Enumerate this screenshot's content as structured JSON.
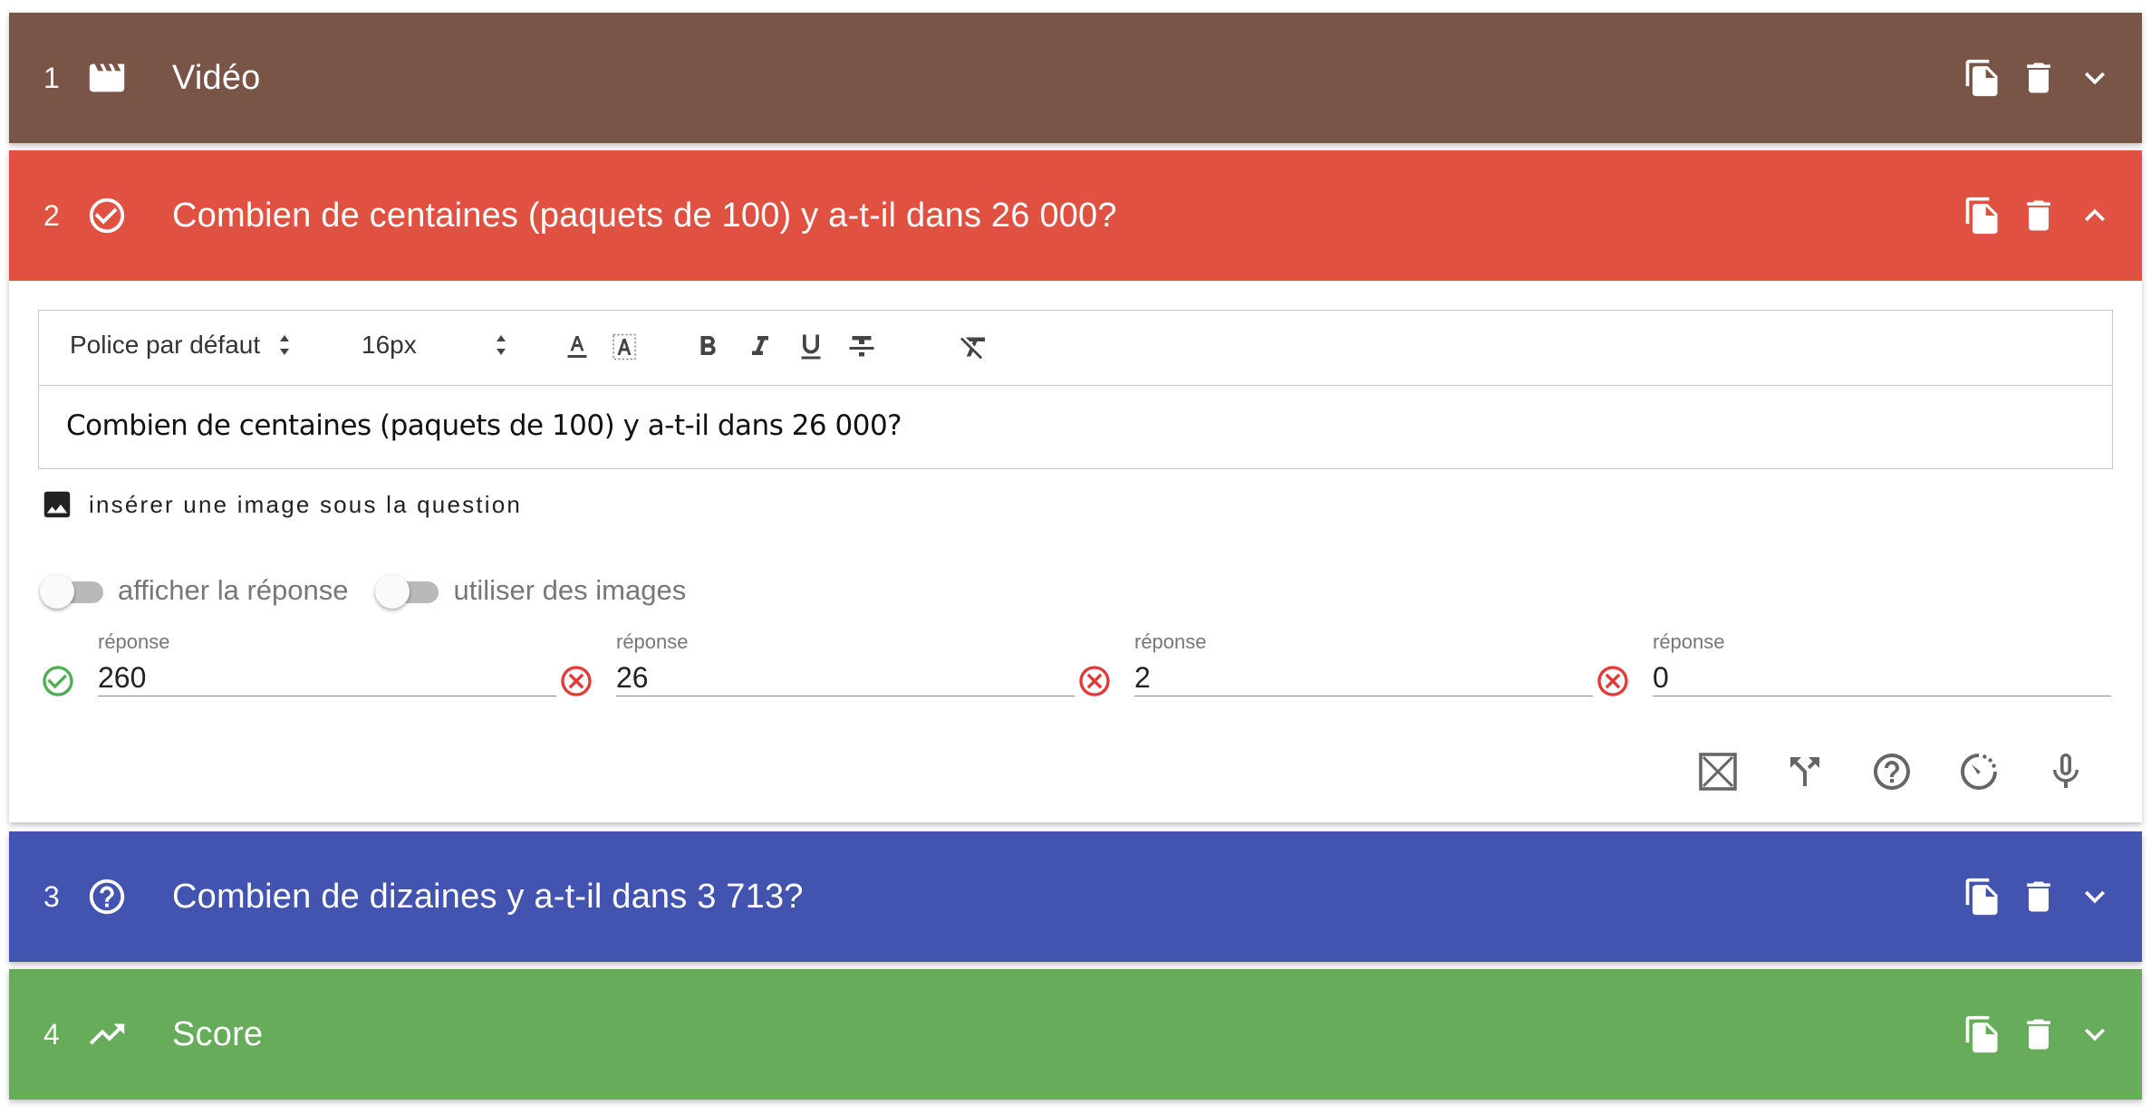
{
  "panels": [
    {
      "number": "1",
      "title": "Vidéo",
      "icon": "clapperboard-icon",
      "color": "#795548"
    },
    {
      "number": "2",
      "title": "Combien de  centaines (paquets de 100) y a-t-il dans 26 000?",
      "icon": "check-circle-icon",
      "color": "#e15141",
      "expanded": true
    },
    {
      "number": "3",
      "title": "Combien de dizaines y a-t-il dans 3 713?",
      "icon": "help-circle-icon",
      "color": "#4354b0"
    },
    {
      "number": "4",
      "title": "Score",
      "icon": "trending-up-icon",
      "color": "#67ac5b"
    }
  ],
  "editor": {
    "font_select": "Police par défaut",
    "size_select": "16px",
    "content": "Combien de  centaines (paquets de 100) y a-t-il dans 26 000?"
  },
  "insert_image_label": "insérer une image sous la question",
  "toggles": [
    {
      "label": "afficher la réponse",
      "on": false
    },
    {
      "label": "utiliser des images",
      "on": false
    }
  ],
  "answers": [
    {
      "label": "réponse",
      "value": "260",
      "correct": true
    },
    {
      "label": "réponse",
      "value": "26",
      "correct": false
    },
    {
      "label": "réponse",
      "value": "2",
      "correct": false
    },
    {
      "label": "réponse",
      "value": "0",
      "correct": false
    }
  ],
  "colors": {
    "correct": "#4caf50",
    "wrong": "#e53935",
    "icon_grey": "#666666"
  }
}
